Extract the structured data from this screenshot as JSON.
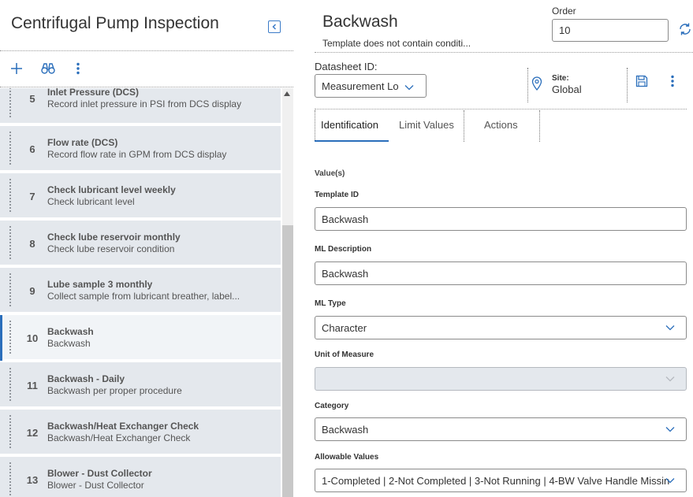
{
  "left": {
    "title": "Centrifugal Pump Inspection",
    "toolbar": {
      "add_icon": "plus-icon",
      "search_icon": "binoculars-icon",
      "menu_icon": "kebab-icon"
    },
    "rows": [
      {
        "num": "5",
        "title": "Inlet Pressure (DCS)",
        "sub": "Record inlet pressure in PSI from DCS display"
      },
      {
        "num": "6",
        "title": "Flow rate (DCS)",
        "sub": "Record flow rate in GPM from DCS display"
      },
      {
        "num": "7",
        "title": "Check lubricant level weekly",
        "sub": "Check lubricant level"
      },
      {
        "num": "8",
        "title": "Check lube reservoir monthly",
        "sub": "Check lube reservoir condition"
      },
      {
        "num": "9",
        "title": "Lube sample 3 monthly",
        "sub": "Collect sample from lubricant breather, label..."
      },
      {
        "num": "10",
        "title": "Backwash",
        "sub": "Backwash"
      },
      {
        "num": "11",
        "title": "Backwash - Daily",
        "sub": "Backwash per proper procedure"
      },
      {
        "num": "12",
        "title": "Backwash/Heat Exchanger Check",
        "sub": "Backwash/Heat Exchanger Check"
      },
      {
        "num": "13",
        "title": "Blower - Dust Collector",
        "sub": "Blower - Dust Collector"
      }
    ]
  },
  "right": {
    "title": "Backwash",
    "subtitle": "Template does not contain conditi...",
    "order_label": "Order",
    "order_value": "10",
    "datasheet_label": "Datasheet ID:",
    "datasheet_value": "Measurement Lo",
    "site_label": "Site:",
    "site_value": "Global",
    "tabs": [
      "Identification",
      "Limit Values",
      "Actions"
    ],
    "section_label": "Value(s)",
    "fields": {
      "template_id": {
        "label": "Template ID",
        "value": "Backwash"
      },
      "ml_description": {
        "label": "ML Description",
        "value": "Backwash"
      },
      "ml_type": {
        "label": "ML Type",
        "value": "Character"
      },
      "unit_of_measure": {
        "label": "Unit of Measure",
        "value": ""
      },
      "category": {
        "label": "Category",
        "value": "Backwash"
      },
      "allowable_values": {
        "label": "Allowable Values",
        "value": "1-Completed | 2-Not Completed | 3-Not Running | 4-BW Valve Handle Missin"
      }
    }
  },
  "colors": {
    "accent": "#2a6ebb",
    "row_bg": "#e4e8ed",
    "row_selected_bg": "#f1f4f7"
  }
}
